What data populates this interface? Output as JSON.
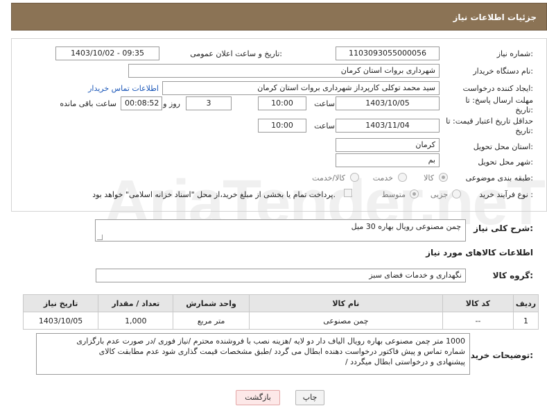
{
  "header": {
    "title": "جزئیات اطلاعات نیاز"
  },
  "form": {
    "need_number_label": "شماره نیاز:",
    "need_number": "1103093055000056",
    "announce_label": "تاریخ و ساعت اعلان عمومی:",
    "announce_value": "1403/10/02 - 09:35",
    "buyer_org_label": "نام دستگاه خریدار:",
    "buyer_org": "شهرداری بروات استان کرمان",
    "requester_label": "ایجاد کننده درخواست:",
    "requester": "سید محمد توکلی کارپرداز شهرداری بروات استان کرمان",
    "contact_link": "اطلاعات تماس خریدار",
    "reply_deadline_label": "مهلت ارسال پاسخ: تا",
    "reply_deadline_label2": "تاریخ:",
    "reply_date": "1403/10/05",
    "time_label": "ساعت",
    "reply_time": "10:00",
    "days_value": "3",
    "days_label": "روز و",
    "remaining_value": "00:08:52",
    "remaining_label": "ساعت باقی مانده",
    "validity_label": "حداقل تاریخ اعتبار قیمت: تا",
    "validity_label2": "تاریخ:",
    "validity_date": "1403/11/04",
    "validity_time_label": "ساعت",
    "validity_time": "10:00",
    "province_label": "استان محل تحویل:",
    "province": "کرمان",
    "city_label": "شهر محل تحویل:",
    "city": "بم",
    "category_label": "طبقه بندی موضوعی:",
    "category_options": [
      "کالا",
      "خدمت",
      "کالا/خدمت"
    ],
    "process_label": "نوع فرآیند خرید :",
    "process_options": [
      "جزیی",
      "متوسط"
    ],
    "payment_note": "پرداخت تمام یا بخشی از مبلغ خرید،از محل \"اسناد خزانه اسلامی\" خواهد بود."
  },
  "description": {
    "label": "شرح کلی نیاز:",
    "value": "چمن مصنوعی رویال بهاره 30 میل"
  },
  "goods_section": {
    "title": "اطلاعات کالاهای مورد نیاز"
  },
  "goods_group": {
    "label": "گروه کالا:",
    "value": "نگهداری و خدمات فضای سبز"
  },
  "table": {
    "headers": [
      "ردیف",
      "کد کالا",
      "نام کالا",
      "واحد شمارش",
      "تعداد / مقدار",
      "تاریخ نیاز"
    ],
    "rows": [
      [
        "1",
        "--",
        "چمن مصنوعی",
        "متر مربع",
        "1,000",
        "1403/10/05"
      ]
    ]
  },
  "buyer_notes": {
    "label": "توضیحات خریدار:",
    "lines": [
      "1000 متر چمن مصنوعی بهاره رویال الیاف دار دو لایه /هزینه نصب با فروشنده محترم /نیاز فوری /در صورت عدم بارگزاری",
      "شماره تماس و پیش فاکتور درخواست دهنده ابطال می گردد /طبق مشخصات قیمت گذاری شود عدم مطابقت کالای",
      "پیشنهادی و درخواستی ابطال میگردد /"
    ]
  },
  "buttons": {
    "print": "چاپ",
    "back": "بازگشت"
  }
}
